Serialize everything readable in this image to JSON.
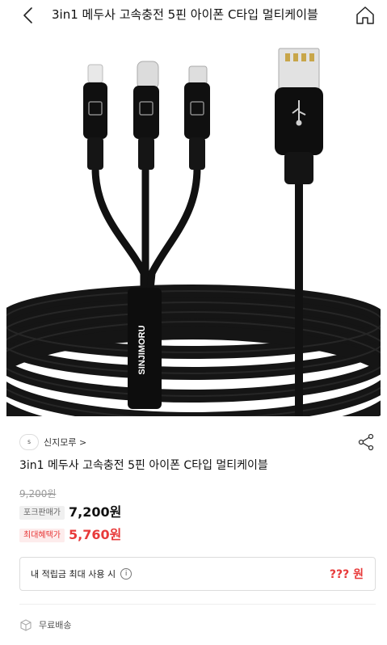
{
  "header": {
    "title": "3in1 메두사 고속충전 5핀 아이폰 C타입 멀티케이블",
    "back_icon": "chevron-left-icon",
    "home_icon": "home-icon"
  },
  "product_image": {
    "brand_text": "SINJIMORU",
    "alt": "3in1 cable product image"
  },
  "seller": {
    "logo_text": "S",
    "name": "신지모루 >"
  },
  "share_icon": "share-icon",
  "product": {
    "name": "3in1 메두사 고속충전 5핀 아이폰 C타입 멀티케이블",
    "original_price": "9,200원",
    "fork_price_label": "포크판매가",
    "fork_price": "7,200원",
    "max_benefit_label": "최대혜택가",
    "max_benefit_price": "5,760원"
  },
  "points": {
    "label": "내 적립금 최대 사용 시",
    "info_icon": "info-icon",
    "value": "??? 원"
  },
  "shipping": {
    "icon": "box-icon",
    "label": "무료배송"
  },
  "colors": {
    "accent_red": "#e83a3a",
    "tag_gray_bg": "#f0f0f0",
    "tag_pink_bg": "#fdecec"
  }
}
